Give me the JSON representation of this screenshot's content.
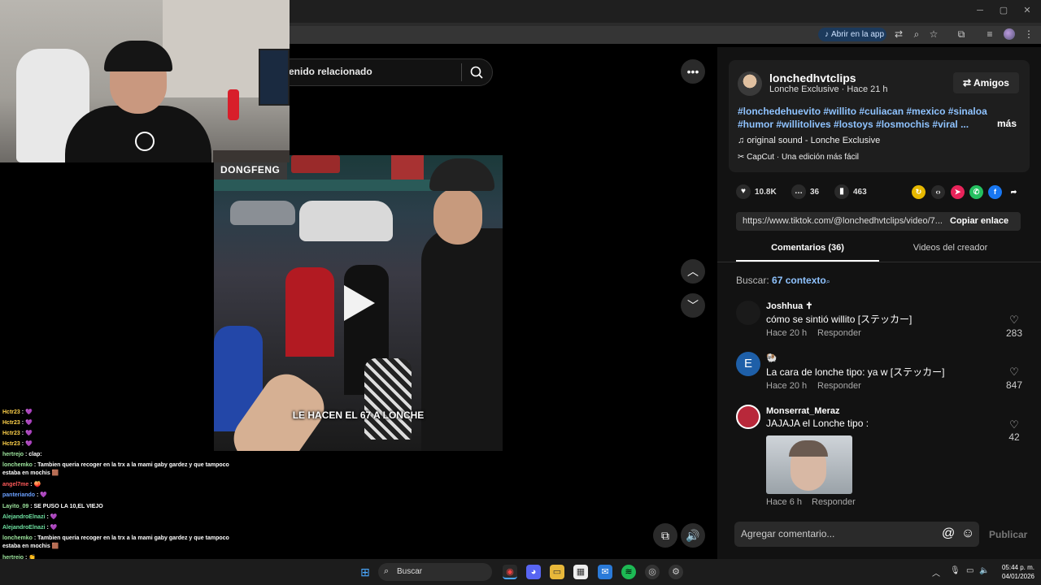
{
  "browser": {
    "open_in_app": "Abrir en la app",
    "minimize": "─",
    "maximize": "▢",
    "close": "✕"
  },
  "search": {
    "text": "enido relacionado"
  },
  "video": {
    "caption": "LE HACEN EL 67 A LONCHE",
    "sign": "DONGFENG"
  },
  "post": {
    "author": "lonchedhvtclips",
    "subtitle": "Lonche Exclusive · Hace 21 h",
    "friends_button": "Amigos",
    "hashtags": "#lonchedehuevito #willito #culiacan #mexico #sinaloa #humor #willitolives #lostoys #losmochis #viral ...",
    "more": "más",
    "sound": "original sound - Lonche Exclusive",
    "capcut": "CapCut · Una edición más fácil",
    "likes": "10.8K",
    "comments": "36",
    "saves": "463",
    "url": "https://www.tiktok.com/@lonchedhvtclips/video/7...",
    "copy_link": "Copiar enlace"
  },
  "tabs": {
    "comments": "Comentarios (36)",
    "videos": "Videos del creador"
  },
  "search_context": {
    "label": "Buscar:",
    "query": "67 contexto"
  },
  "comments": [
    {
      "name": "Joshhua ✝",
      "text": "cómo se sintió willito [ステッカー]",
      "time": "Hace 20 h",
      "reply": "Responder",
      "likes": "283",
      "avatar_color": "#1a1a1a"
    },
    {
      "name": "🐏",
      "text": "La cara de lonche tipo: ya w [ステッカー]",
      "time": "Hace 20 h",
      "reply": "Responder",
      "likes": "847",
      "avatar_letter": "E",
      "avatar_color": "#1e5fa8"
    },
    {
      "name": "Monserrat_Meraz",
      "text": "JAJAJA el Lonche tipo :",
      "time": "Hace 6 h",
      "reply": "Responder",
      "likes": "42",
      "avatar_color": "#b8283a"
    }
  ],
  "add_comment": {
    "placeholder": "Agregar comentario...",
    "publish": "Publicar"
  },
  "chat": [
    {
      "user": "Hctr23",
      "msg": " : 💜"
    },
    {
      "user": "Hctr23",
      "msg": " : 💜"
    },
    {
      "user": "Hctr23",
      "msg": " : 💜"
    },
    {
      "user": "Hctr23",
      "msg": " : 💜"
    },
    {
      "user": "hertrejo",
      "msg": " : clap:"
    },
    {
      "user": "lonchemko",
      "msg": " : Tambien queria recoger en la trx a la mami gaby gardez y que tampoco estaba en mochis 🟫"
    },
    {
      "user": "angel7me",
      "msg": " : 🍑"
    },
    {
      "user": "panteriando",
      "msg": " : 💜"
    },
    {
      "user": "Layito_09",
      "msg": " : SE PUSO LA 10,EL VIEJO"
    },
    {
      "user": "AlejandroElnazi",
      "msg": " : 💜"
    },
    {
      "user": "AlejandroElnazi",
      "msg": " : 💜"
    },
    {
      "user": "lonchemko",
      "msg": " : Tambien queria recoger en la trx a la mami gaby gardez y que tampoco estaba en mochis 🟫"
    },
    {
      "user": "hertrejo",
      "msg": " : 👏"
    },
    {
      "user": "lonchemko",
      "msg": " : Tambien queria recoger en la trx a la mami gaby gardez y que tampoco estaba en mochis 🟫"
    }
  ],
  "taskbar": {
    "search": "Buscar",
    "time": "05:44 p. m.",
    "date": "04/01/2026"
  }
}
